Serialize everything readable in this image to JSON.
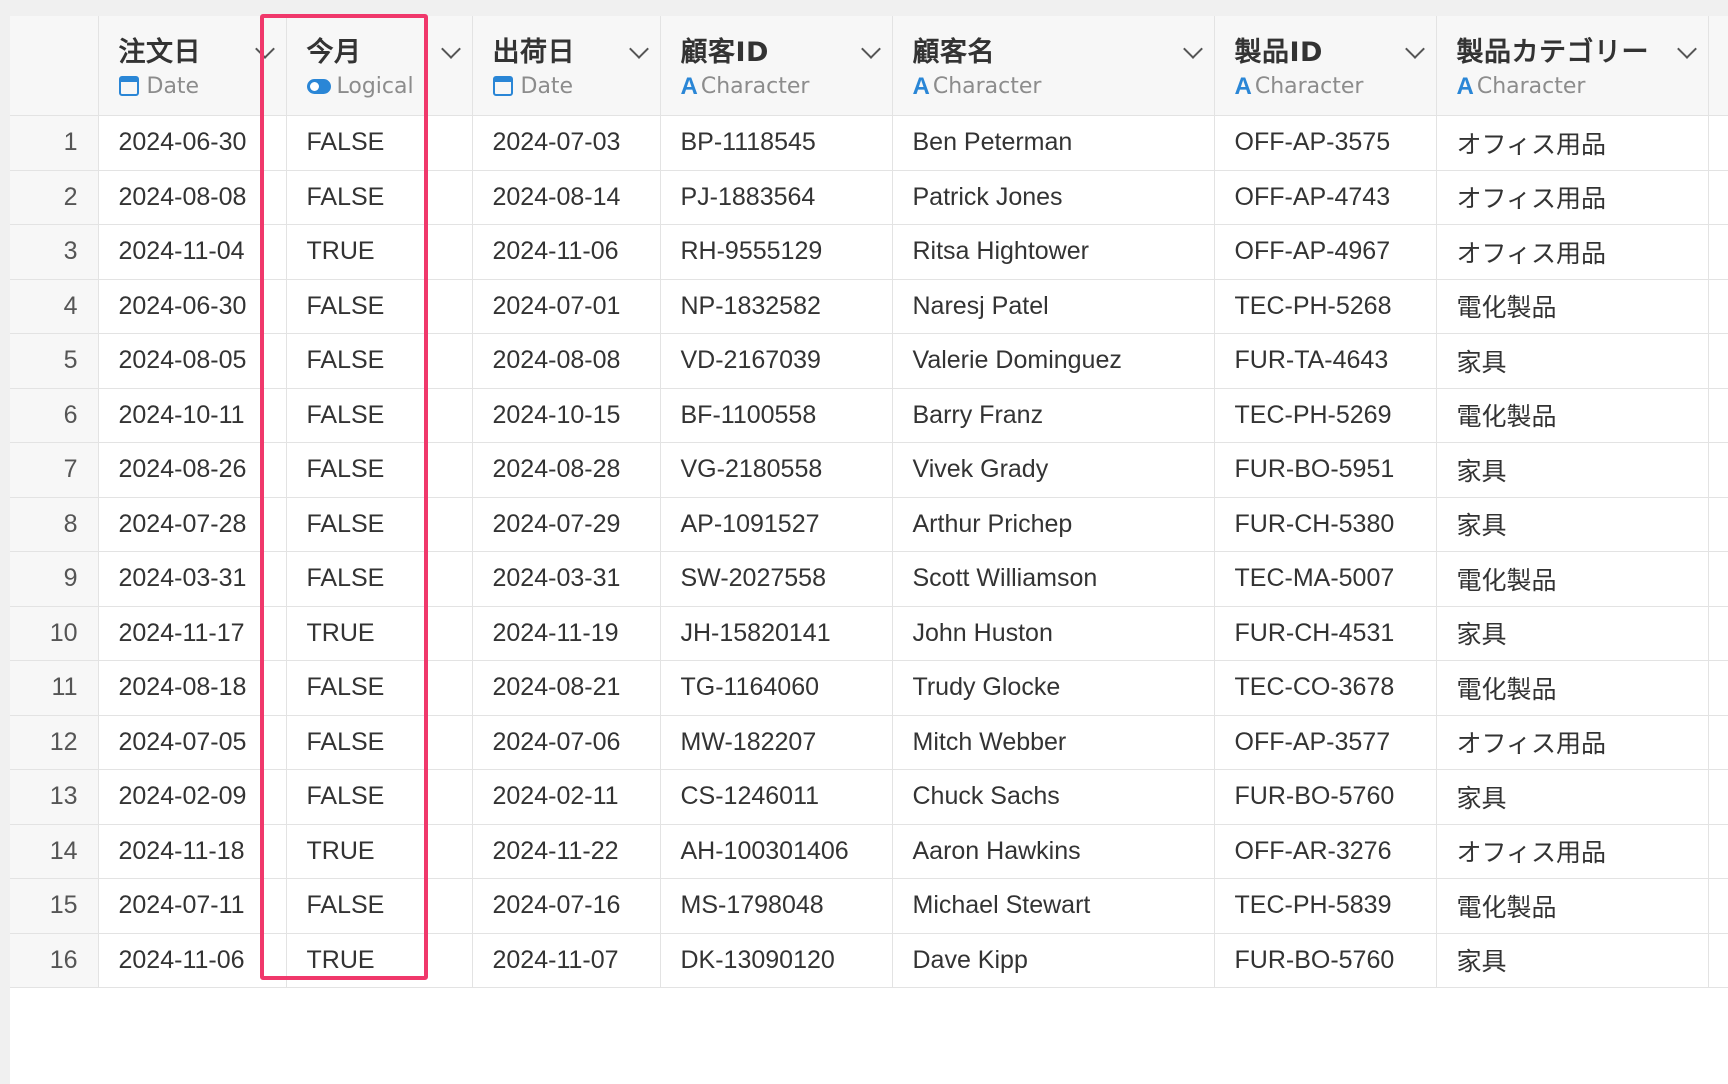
{
  "columns": [
    {
      "name": "注文日",
      "type": "Date",
      "type_icon": "calendar-icon"
    },
    {
      "name": "今月",
      "type": "Logical",
      "type_icon": "toggle-icon"
    },
    {
      "name": "出荷日",
      "type": "Date",
      "type_icon": "calendar-icon"
    },
    {
      "name": "顧客ID",
      "type": "Character",
      "type_icon": "character-icon"
    },
    {
      "name": "顧客名",
      "type": "Character",
      "type_icon": "character-icon"
    },
    {
      "name": "製品ID",
      "type": "Character",
      "type_icon": "character-icon"
    },
    {
      "name": "製品カテゴリー",
      "type": "Character",
      "type_icon": "character-icon"
    }
  ],
  "char_icon_glyph": "A",
  "rows": [
    {
      "idx": "1",
      "cells": [
        "2024-06-30",
        "FALSE",
        "2024-07-03",
        "BP-1118545",
        "Ben Peterman",
        "OFF-AP-3575",
        "オフィス用品"
      ]
    },
    {
      "idx": "2",
      "cells": [
        "2024-08-08",
        "FALSE",
        "2024-08-14",
        "PJ-1883564",
        "Patrick Jones",
        "OFF-AP-4743",
        "オフィス用品"
      ]
    },
    {
      "idx": "3",
      "cells": [
        "2024-11-04",
        "TRUE",
        "2024-11-06",
        "RH-9555129",
        "Ritsa Hightower",
        "OFF-AP-4967",
        "オフィス用品"
      ]
    },
    {
      "idx": "4",
      "cells": [
        "2024-06-30",
        "FALSE",
        "2024-07-01",
        "NP-1832582",
        "Naresj Patel",
        "TEC-PH-5268",
        "電化製品"
      ]
    },
    {
      "idx": "5",
      "cells": [
        "2024-08-05",
        "FALSE",
        "2024-08-08",
        "VD-2167039",
        "Valerie Dominguez",
        "FUR-TA-4643",
        "家具"
      ]
    },
    {
      "idx": "6",
      "cells": [
        "2024-10-11",
        "FALSE",
        "2024-10-15",
        "BF-1100558",
        "Barry Franz",
        "TEC-PH-5269",
        "電化製品"
      ]
    },
    {
      "idx": "7",
      "cells": [
        "2024-08-26",
        "FALSE",
        "2024-08-28",
        "VG-2180558",
        "Vivek Grady",
        "FUR-BO-5951",
        "家具"
      ]
    },
    {
      "idx": "8",
      "cells": [
        "2024-07-28",
        "FALSE",
        "2024-07-29",
        "AP-1091527",
        "Arthur Prichep",
        "FUR-CH-5380",
        "家具"
      ]
    },
    {
      "idx": "9",
      "cells": [
        "2024-03-31",
        "FALSE",
        "2024-03-31",
        "SW-2027558",
        "Scott Williamson",
        "TEC-MA-5007",
        "電化製品"
      ]
    },
    {
      "idx": "10",
      "cells": [
        "2024-11-17",
        "TRUE",
        "2024-11-19",
        "JH-15820141",
        "John Huston",
        "FUR-CH-4531",
        "家具"
      ]
    },
    {
      "idx": "11",
      "cells": [
        "2024-08-18",
        "FALSE",
        "2024-08-21",
        "TG-1164060",
        "Trudy Glocke",
        "TEC-CO-3678",
        "電化製品"
      ]
    },
    {
      "idx": "12",
      "cells": [
        "2024-07-05",
        "FALSE",
        "2024-07-06",
        "MW-182207",
        "Mitch Webber",
        "OFF-AP-3577",
        "オフィス用品"
      ]
    },
    {
      "idx": "13",
      "cells": [
        "2024-02-09",
        "FALSE",
        "2024-02-11",
        "CS-1246011",
        "Chuck Sachs",
        "FUR-BO-5760",
        "家具"
      ]
    },
    {
      "idx": "14",
      "cells": [
        "2024-11-18",
        "TRUE",
        "2024-11-22",
        "AH-100301406",
        "Aaron Hawkins",
        "OFF-AR-3276",
        "オフィス用品"
      ]
    },
    {
      "idx": "15",
      "cells": [
        "2024-07-11",
        "FALSE",
        "2024-07-16",
        "MS-1798048",
        "Michael Stewart",
        "TEC-PH-5839",
        "電化製品"
      ]
    },
    {
      "idx": "16",
      "cells": [
        "2024-11-06",
        "TRUE",
        "2024-11-07",
        "DK-13090120",
        "Dave Kipp",
        "FUR-BO-5760",
        "家具"
      ]
    }
  ],
  "colors": {
    "accent": "#2a86d6",
    "highlight": "#f0386b",
    "header_bg": "#f7f7f7",
    "grid": "#e3e3e3"
  }
}
